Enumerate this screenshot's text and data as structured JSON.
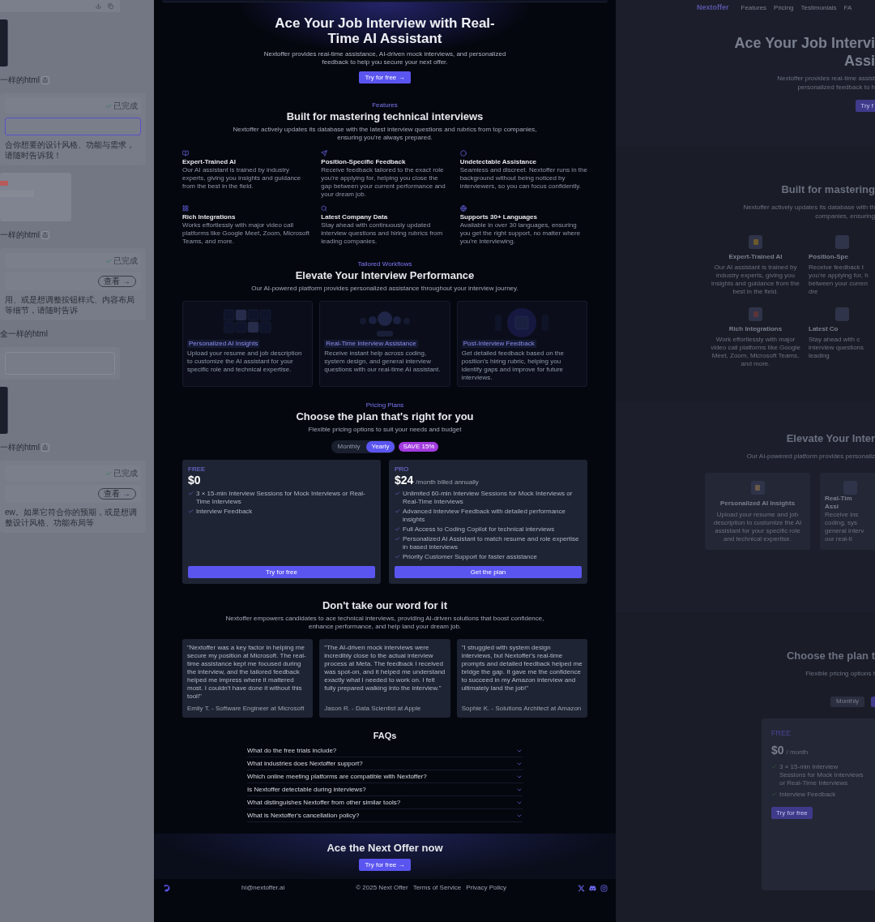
{
  "chat_panel": {
    "items": [
      {
        "kind": "image"
      },
      {
        "kind": "file",
        "label": "一样的html",
        "share": true
      },
      {
        "kind": "reply",
        "status": "已完成",
        "message": "合你想要的设计风格、功能与需求，请随时告诉我！"
      },
      {
        "kind": "preview"
      },
      {
        "kind": "file",
        "label": "一样的html",
        "share": true
      },
      {
        "kind": "reply",
        "status": "已完成",
        "view_label": "查看 →",
        "message": "用、或是想调整按钮样式、内容布局等细节，请随时告诉"
      },
      {
        "kind": "file",
        "label": "全一样的html",
        "share": false
      },
      {
        "kind": "prompt"
      },
      {
        "kind": "image"
      },
      {
        "kind": "file",
        "label": "一样的html",
        "share": true
      },
      {
        "kind": "reply",
        "status": "已完成",
        "view_label": "查看 →",
        "message": "ew。如果它符合你的预期，或是想调整设计风格、功能布局等"
      }
    ]
  },
  "landing_page": {
    "hero": {
      "title": "Ace Your Job Interview with Real-Time AI Assistant",
      "subtitle": "Nextoffer provides real-time assistance, AI-driven mock interviews, and personalized feedback to help you secure your next offer.",
      "cta": "Try for free →"
    },
    "features": {
      "label": "Features",
      "title": "Built for mastering technical interviews",
      "description": "Nextoffer actively updates its database with the latest interview questions and rubrics from top companies, ensuring you're always prepared.",
      "items": [
        {
          "title": "Expert-Trained AI",
          "text": "Our AI assistant is trained by industry experts, giving you insights and guidance from the best in the field."
        },
        {
          "title": "Position-Specific Feedback",
          "text": "Receive feedback tailored to the exact role you're applying for, helping you close the gap between your current performance and your dream job."
        },
        {
          "title": "Undetectable Assistance",
          "text": "Seamless and discreet. Nextoffer runs in the background without being noticed by interviewers, so you can focus confidently."
        },
        {
          "title": "Rich Integrations",
          "text": "Works effortlessly with major video call platforms like Google Meet, Zoom, Microsoft Teams, and more."
        },
        {
          "title": "Latest Company Data",
          "text": "Stay ahead with continuously updated interview questions and hiring rubrics from leading companies."
        },
        {
          "title": "Supports 30+ Languages",
          "text": "Available in over 30 languages, ensuring you get the right support, no matter where you're interviewing."
        }
      ]
    },
    "workflows": {
      "label": "Tailored Workflows",
      "title": "Elevate Your Interview Performance",
      "description": "Our AI-powered platform provides personalized assistance throughout your interview journey.",
      "cards": [
        {
          "kind": "grid",
          "tag": "Personalized AI Insights",
          "text": "Upload your resume and job description to customize the AI assistant for your specific role and technical expertise."
        },
        {
          "kind": "controls",
          "tag": "Real-Time Interview Assistance",
          "text": "Receive instant help across coding, system design, and general interview questions with our real-time AI assistant."
        },
        {
          "kind": "glow",
          "tag": "Post-Interview Feedback",
          "text": "Get detailed feedback based on the position's hiring rubric, helping you identify gaps and improve for future interviews."
        }
      ]
    },
    "pricing": {
      "label": "Pricing Plans",
      "title": "Choose the plan that's right for you",
      "description": "Flexible pricing options to suit your needs and budget",
      "billing": [
        {
          "label": "Monthly",
          "selected": false
        },
        {
          "label": "Yearly",
          "selected": true
        }
      ],
      "badge": "SAVE 15%",
      "plans": [
        {
          "name": "FREE",
          "price": "$0",
          "features": [
            "3 × 15-min Interview Sessions for Mock Interviews or Real-Time Interviews",
            "Interview Feedback"
          ],
          "button": "Try for free"
        },
        {
          "name": "PRO",
          "price": "$24",
          "period": "/month billed annually",
          "features": [
            "Unlimited 60-min Interview Sessions for Mock Interviews or Real-Time Interviews",
            "Advanced Interview Feedback with detailed performance insights",
            "Full Access to Coding Copilot for technical interviews",
            "Personalized AI Assistant to match resume and role expertise in based interviews",
            "Priority Customer Support for faster assistance"
          ],
          "button": "Get the plan"
        }
      ]
    },
    "testimonials": {
      "title": "Don't take our word for it",
      "description": "Nextoffer empowers candidates to ace technical interviews, providing AI-driven solutions that boost confidence, enhance performance, and help land your dream job.",
      "items": [
        {
          "quote": "\"Nextoffer was a key factor in helping me secure my position at Microsoft. The real-time assistance kept me focused during the interview, and the tailored feedback helped me impress where it mattered most. I couldn't have done it without this tool!\"",
          "author": "Emily T. - Software Engineer at Microsoft"
        },
        {
          "quote": "\"The AI-driven mock interviews were incredibly close to the actual interview process at Meta. The feedback I received was spot-on, and it helped me understand exactly what I needed to work on. I felt fully prepared walking into the interview.\"",
          "author": "Jason R. - Data Scientist at Apple"
        },
        {
          "quote": "\"I struggled with system design interviews, but Nextoffer's real-time prompts and detailed feedback helped me bridge the gap. It gave me the confidence to succeed in my Amazon interview and ultimately land the job!\"",
          "author": "Sophie K. - Solutions Architect at Amazon"
        }
      ]
    },
    "faqs": {
      "title": "FAQs",
      "items": [
        {
          "question": "What do the free trials include?",
          "expanded": false
        },
        {
          "question": "What industries does Nextoffer support?",
          "expanded": false
        },
        {
          "question": "Which online meeting platforms are compatible with Nextoffer?",
          "expanded": false
        },
        {
          "question": "Is Nextoffer detectable during interviews?",
          "expanded": false
        },
        {
          "question": "What distinguishes Nextoffer from other similar tools?",
          "expanded": false
        },
        {
          "question": "What is Nextoffer's cancellation policy?",
          "expanded": false
        }
      ]
    },
    "cta": {
      "title": "Ace the Next Offer now",
      "button": "Try for free →"
    },
    "footer": {
      "email": "hi@nextoffer.ai",
      "copyright": "© 2025 Next Offer",
      "links": [
        "Terms of Service",
        "Privacy Policy"
      ]
    }
  },
  "preview_page": {
    "nav": {
      "brand": "Nextoffer",
      "links": [
        "Features",
        "Pricing",
        "Testimonials",
        "FA"
      ]
    },
    "hero": {
      "title_lines": [
        "Ace Your Job Intervi",
        "Assi"
      ],
      "subtitle_lines": [
        "Nextoffer provides real-time assist",
        "personalized feedback to h"
      ],
      "button": "Try f"
    },
    "features": {
      "title": "Built for mastering",
      "description_lines": [
        "Nextoffer actively updates its database with th",
        "companies, ensuring"
      ],
      "rows": [
        {
          "title": "Expert-Trained AI",
          "text": "Our AI assistant is trained by industry experts, giving you insights and guidance from the best in the field.",
          "next_title": "Position-Spe",
          "next_lines": [
            "Receive feedback t",
            "you're applying for, h",
            "between your curren",
            "dre"
          ]
        },
        {
          "title": "Rich Integrations",
          "text": "Work effortlessly with major video call platforms like Google Meet, Zoom, Microsoft Teams, and more.",
          "next_title": "Latest Co",
          "next_lines": [
            "Stay ahead with c",
            "interview questions",
            "leading"
          ]
        }
      ]
    },
    "workflows": {
      "title": "Elevate Your Inter",
      "description": "Our AI-powered platform provides personaliz",
      "card": {
        "title": "Personalized AI Insights",
        "text": "Upload your resume and job description to customize the AI assistant for your specific role and technical expertise."
      },
      "next_card": {
        "title_lines": [
          "Real-Tim",
          "Assi"
        ],
        "lines": [
          "Receive ins",
          "coding, sys",
          "general interv",
          "our real-ti"
        ]
      }
    },
    "pricing": {
      "title": "Choose the plan t",
      "description": "Flexible pricing options t",
      "billing": [
        {
          "label": "Monthly",
          "selected": false
        },
        {
          "selected": true
        }
      ],
      "plan": {
        "name": "FREE",
        "price": "$0",
        "period": "/ month",
        "features": [
          "3 × 15-min Interview Sessions for Mock Interviews or Real-Time Interviews",
          "Interview Feedback"
        ],
        "button": "Try for free"
      }
    }
  }
}
